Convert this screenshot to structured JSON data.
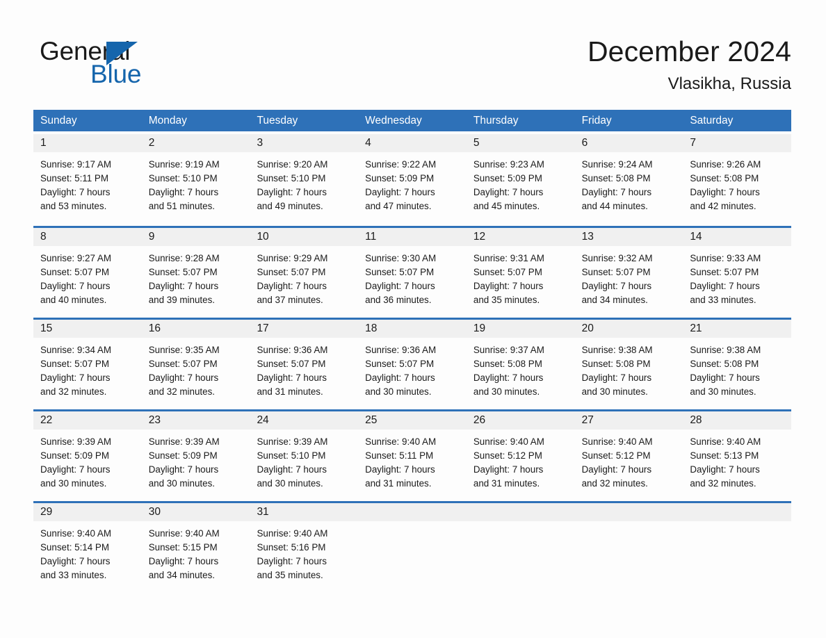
{
  "brand": {
    "name_part1": "General",
    "name_part2": "Blue",
    "accent_color": "#1565ac"
  },
  "header": {
    "title": "December 2024",
    "subtitle": "Vlasikha, Russia"
  },
  "theme": {
    "header_blue": "#2e71b8",
    "daynum_band": "#f0f0f0",
    "page_background": "#fdfdfd",
    "text": "#1a1a1a"
  },
  "weekday_headers": [
    "Sunday",
    "Monday",
    "Tuesday",
    "Wednesday",
    "Thursday",
    "Friday",
    "Saturday"
  ],
  "weeks": [
    [
      {
        "day": "1",
        "sunrise": "Sunrise: 9:17 AM",
        "sunset": "Sunset: 5:11 PM",
        "daylight1": "Daylight: 7 hours",
        "daylight2": "and 53 minutes."
      },
      {
        "day": "2",
        "sunrise": "Sunrise: 9:19 AM",
        "sunset": "Sunset: 5:10 PM",
        "daylight1": "Daylight: 7 hours",
        "daylight2": "and 51 minutes."
      },
      {
        "day": "3",
        "sunrise": "Sunrise: 9:20 AM",
        "sunset": "Sunset: 5:10 PM",
        "daylight1": "Daylight: 7 hours",
        "daylight2": "and 49 minutes."
      },
      {
        "day": "4",
        "sunrise": "Sunrise: 9:22 AM",
        "sunset": "Sunset: 5:09 PM",
        "daylight1": "Daylight: 7 hours",
        "daylight2": "and 47 minutes."
      },
      {
        "day": "5",
        "sunrise": "Sunrise: 9:23 AM",
        "sunset": "Sunset: 5:09 PM",
        "daylight1": "Daylight: 7 hours",
        "daylight2": "and 45 minutes."
      },
      {
        "day": "6",
        "sunrise": "Sunrise: 9:24 AM",
        "sunset": "Sunset: 5:08 PM",
        "daylight1": "Daylight: 7 hours",
        "daylight2": "and 44 minutes."
      },
      {
        "day": "7",
        "sunrise": "Sunrise: 9:26 AM",
        "sunset": "Sunset: 5:08 PM",
        "daylight1": "Daylight: 7 hours",
        "daylight2": "and 42 minutes."
      }
    ],
    [
      {
        "day": "8",
        "sunrise": "Sunrise: 9:27 AM",
        "sunset": "Sunset: 5:07 PM",
        "daylight1": "Daylight: 7 hours",
        "daylight2": "and 40 minutes."
      },
      {
        "day": "9",
        "sunrise": "Sunrise: 9:28 AM",
        "sunset": "Sunset: 5:07 PM",
        "daylight1": "Daylight: 7 hours",
        "daylight2": "and 39 minutes."
      },
      {
        "day": "10",
        "sunrise": "Sunrise: 9:29 AM",
        "sunset": "Sunset: 5:07 PM",
        "daylight1": "Daylight: 7 hours",
        "daylight2": "and 37 minutes."
      },
      {
        "day": "11",
        "sunrise": "Sunrise: 9:30 AM",
        "sunset": "Sunset: 5:07 PM",
        "daylight1": "Daylight: 7 hours",
        "daylight2": "and 36 minutes."
      },
      {
        "day": "12",
        "sunrise": "Sunrise: 9:31 AM",
        "sunset": "Sunset: 5:07 PM",
        "daylight1": "Daylight: 7 hours",
        "daylight2": "and 35 minutes."
      },
      {
        "day": "13",
        "sunrise": "Sunrise: 9:32 AM",
        "sunset": "Sunset: 5:07 PM",
        "daylight1": "Daylight: 7 hours",
        "daylight2": "and 34 minutes."
      },
      {
        "day": "14",
        "sunrise": "Sunrise: 9:33 AM",
        "sunset": "Sunset: 5:07 PM",
        "daylight1": "Daylight: 7 hours",
        "daylight2": "and 33 minutes."
      }
    ],
    [
      {
        "day": "15",
        "sunrise": "Sunrise: 9:34 AM",
        "sunset": "Sunset: 5:07 PM",
        "daylight1": "Daylight: 7 hours",
        "daylight2": "and 32 minutes."
      },
      {
        "day": "16",
        "sunrise": "Sunrise: 9:35 AM",
        "sunset": "Sunset: 5:07 PM",
        "daylight1": "Daylight: 7 hours",
        "daylight2": "and 32 minutes."
      },
      {
        "day": "17",
        "sunrise": "Sunrise: 9:36 AM",
        "sunset": "Sunset: 5:07 PM",
        "daylight1": "Daylight: 7 hours",
        "daylight2": "and 31 minutes."
      },
      {
        "day": "18",
        "sunrise": "Sunrise: 9:36 AM",
        "sunset": "Sunset: 5:07 PM",
        "daylight1": "Daylight: 7 hours",
        "daylight2": "and 30 minutes."
      },
      {
        "day": "19",
        "sunrise": "Sunrise: 9:37 AM",
        "sunset": "Sunset: 5:08 PM",
        "daylight1": "Daylight: 7 hours",
        "daylight2": "and 30 minutes."
      },
      {
        "day": "20",
        "sunrise": "Sunrise: 9:38 AM",
        "sunset": "Sunset: 5:08 PM",
        "daylight1": "Daylight: 7 hours",
        "daylight2": "and 30 minutes."
      },
      {
        "day": "21",
        "sunrise": "Sunrise: 9:38 AM",
        "sunset": "Sunset: 5:08 PM",
        "daylight1": "Daylight: 7 hours",
        "daylight2": "and 30 minutes."
      }
    ],
    [
      {
        "day": "22",
        "sunrise": "Sunrise: 9:39 AM",
        "sunset": "Sunset: 5:09 PM",
        "daylight1": "Daylight: 7 hours",
        "daylight2": "and 30 minutes."
      },
      {
        "day": "23",
        "sunrise": "Sunrise: 9:39 AM",
        "sunset": "Sunset: 5:09 PM",
        "daylight1": "Daylight: 7 hours",
        "daylight2": "and 30 minutes."
      },
      {
        "day": "24",
        "sunrise": "Sunrise: 9:39 AM",
        "sunset": "Sunset: 5:10 PM",
        "daylight1": "Daylight: 7 hours",
        "daylight2": "and 30 minutes."
      },
      {
        "day": "25",
        "sunrise": "Sunrise: 9:40 AM",
        "sunset": "Sunset: 5:11 PM",
        "daylight1": "Daylight: 7 hours",
        "daylight2": "and 31 minutes."
      },
      {
        "day": "26",
        "sunrise": "Sunrise: 9:40 AM",
        "sunset": "Sunset: 5:12 PM",
        "daylight1": "Daylight: 7 hours",
        "daylight2": "and 31 minutes."
      },
      {
        "day": "27",
        "sunrise": "Sunrise: 9:40 AM",
        "sunset": "Sunset: 5:12 PM",
        "daylight1": "Daylight: 7 hours",
        "daylight2": "and 32 minutes."
      },
      {
        "day": "28",
        "sunrise": "Sunrise: 9:40 AM",
        "sunset": "Sunset: 5:13 PM",
        "daylight1": "Daylight: 7 hours",
        "daylight2": "and 32 minutes."
      }
    ],
    [
      {
        "day": "29",
        "sunrise": "Sunrise: 9:40 AM",
        "sunset": "Sunset: 5:14 PM",
        "daylight1": "Daylight: 7 hours",
        "daylight2": "and 33 minutes."
      },
      {
        "day": "30",
        "sunrise": "Sunrise: 9:40 AM",
        "sunset": "Sunset: 5:15 PM",
        "daylight1": "Daylight: 7 hours",
        "daylight2": "and 34 minutes."
      },
      {
        "day": "31",
        "sunrise": "Sunrise: 9:40 AM",
        "sunset": "Sunset: 5:16 PM",
        "daylight1": "Daylight: 7 hours",
        "daylight2": "and 35 minutes."
      },
      {
        "day": "",
        "sunrise": "",
        "sunset": "",
        "daylight1": "",
        "daylight2": ""
      },
      {
        "day": "",
        "sunrise": "",
        "sunset": "",
        "daylight1": "",
        "daylight2": ""
      },
      {
        "day": "",
        "sunrise": "",
        "sunset": "",
        "daylight1": "",
        "daylight2": ""
      },
      {
        "day": "",
        "sunrise": "",
        "sunset": "",
        "daylight1": "",
        "daylight2": ""
      }
    ]
  ]
}
